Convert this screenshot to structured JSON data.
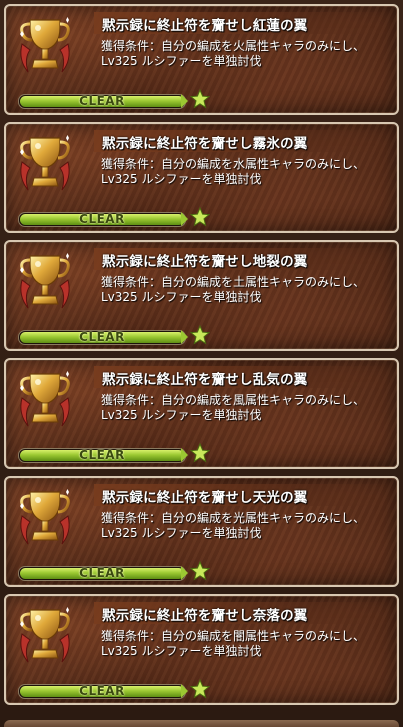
{
  "achievements": [
    {
      "title": "黙示録に終止符を齎せし紅蓮の翼",
      "desc_line1": "獲得条件：自分の編成を火属性キャラのみにし、",
      "desc_line2": "Lv325 ルシファーを単独討伐",
      "status": "CLEAR",
      "progress": 1.0
    },
    {
      "title": "黙示録に終止符を齎せし霧氷の翼",
      "desc_line1": "獲得条件：自分の編成を水属性キャラのみにし、",
      "desc_line2": "Lv325 ルシファーを単独討伐",
      "status": "CLEAR",
      "progress": 1.0
    },
    {
      "title": "黙示録に終止符を齎せし地裂の翼",
      "desc_line1": "獲得条件：自分の編成を土属性キャラのみにし、",
      "desc_line2": "Lv325 ルシファーを単独討伐",
      "status": "CLEAR",
      "progress": 1.0
    },
    {
      "title": "黙示録に終止符を齎せし乱気の翼",
      "desc_line1": "獲得条件：自分の編成を風属性キャラのみにし、",
      "desc_line2": "Lv325 ルシファーを単独討伐",
      "status": "CLEAR",
      "progress": 1.0
    },
    {
      "title": "黙示録に終止符を齎せし天光の翼",
      "desc_line1": "獲得条件：自分の編成を光属性キャラのみにし、",
      "desc_line2": "Lv325 ルシファーを単独討伐",
      "status": "CLEAR",
      "progress": 1.0
    },
    {
      "title": "黙示録に終止符を齎せし奈落の翼",
      "desc_line1": "獲得条件：自分の編成を闇属性キャラのみにし、",
      "desc_line2": "Lv325 ルシファーを単独討伐",
      "status": "CLEAR",
      "progress": 1.0
    }
  ],
  "icons": {
    "trophy": "gold-trophy-icon",
    "star": "green-star-icon"
  },
  "colors": {
    "gauge_fill": "#9bc832",
    "card_border": "#d8c8b2",
    "title_text": "#ffffff"
  }
}
